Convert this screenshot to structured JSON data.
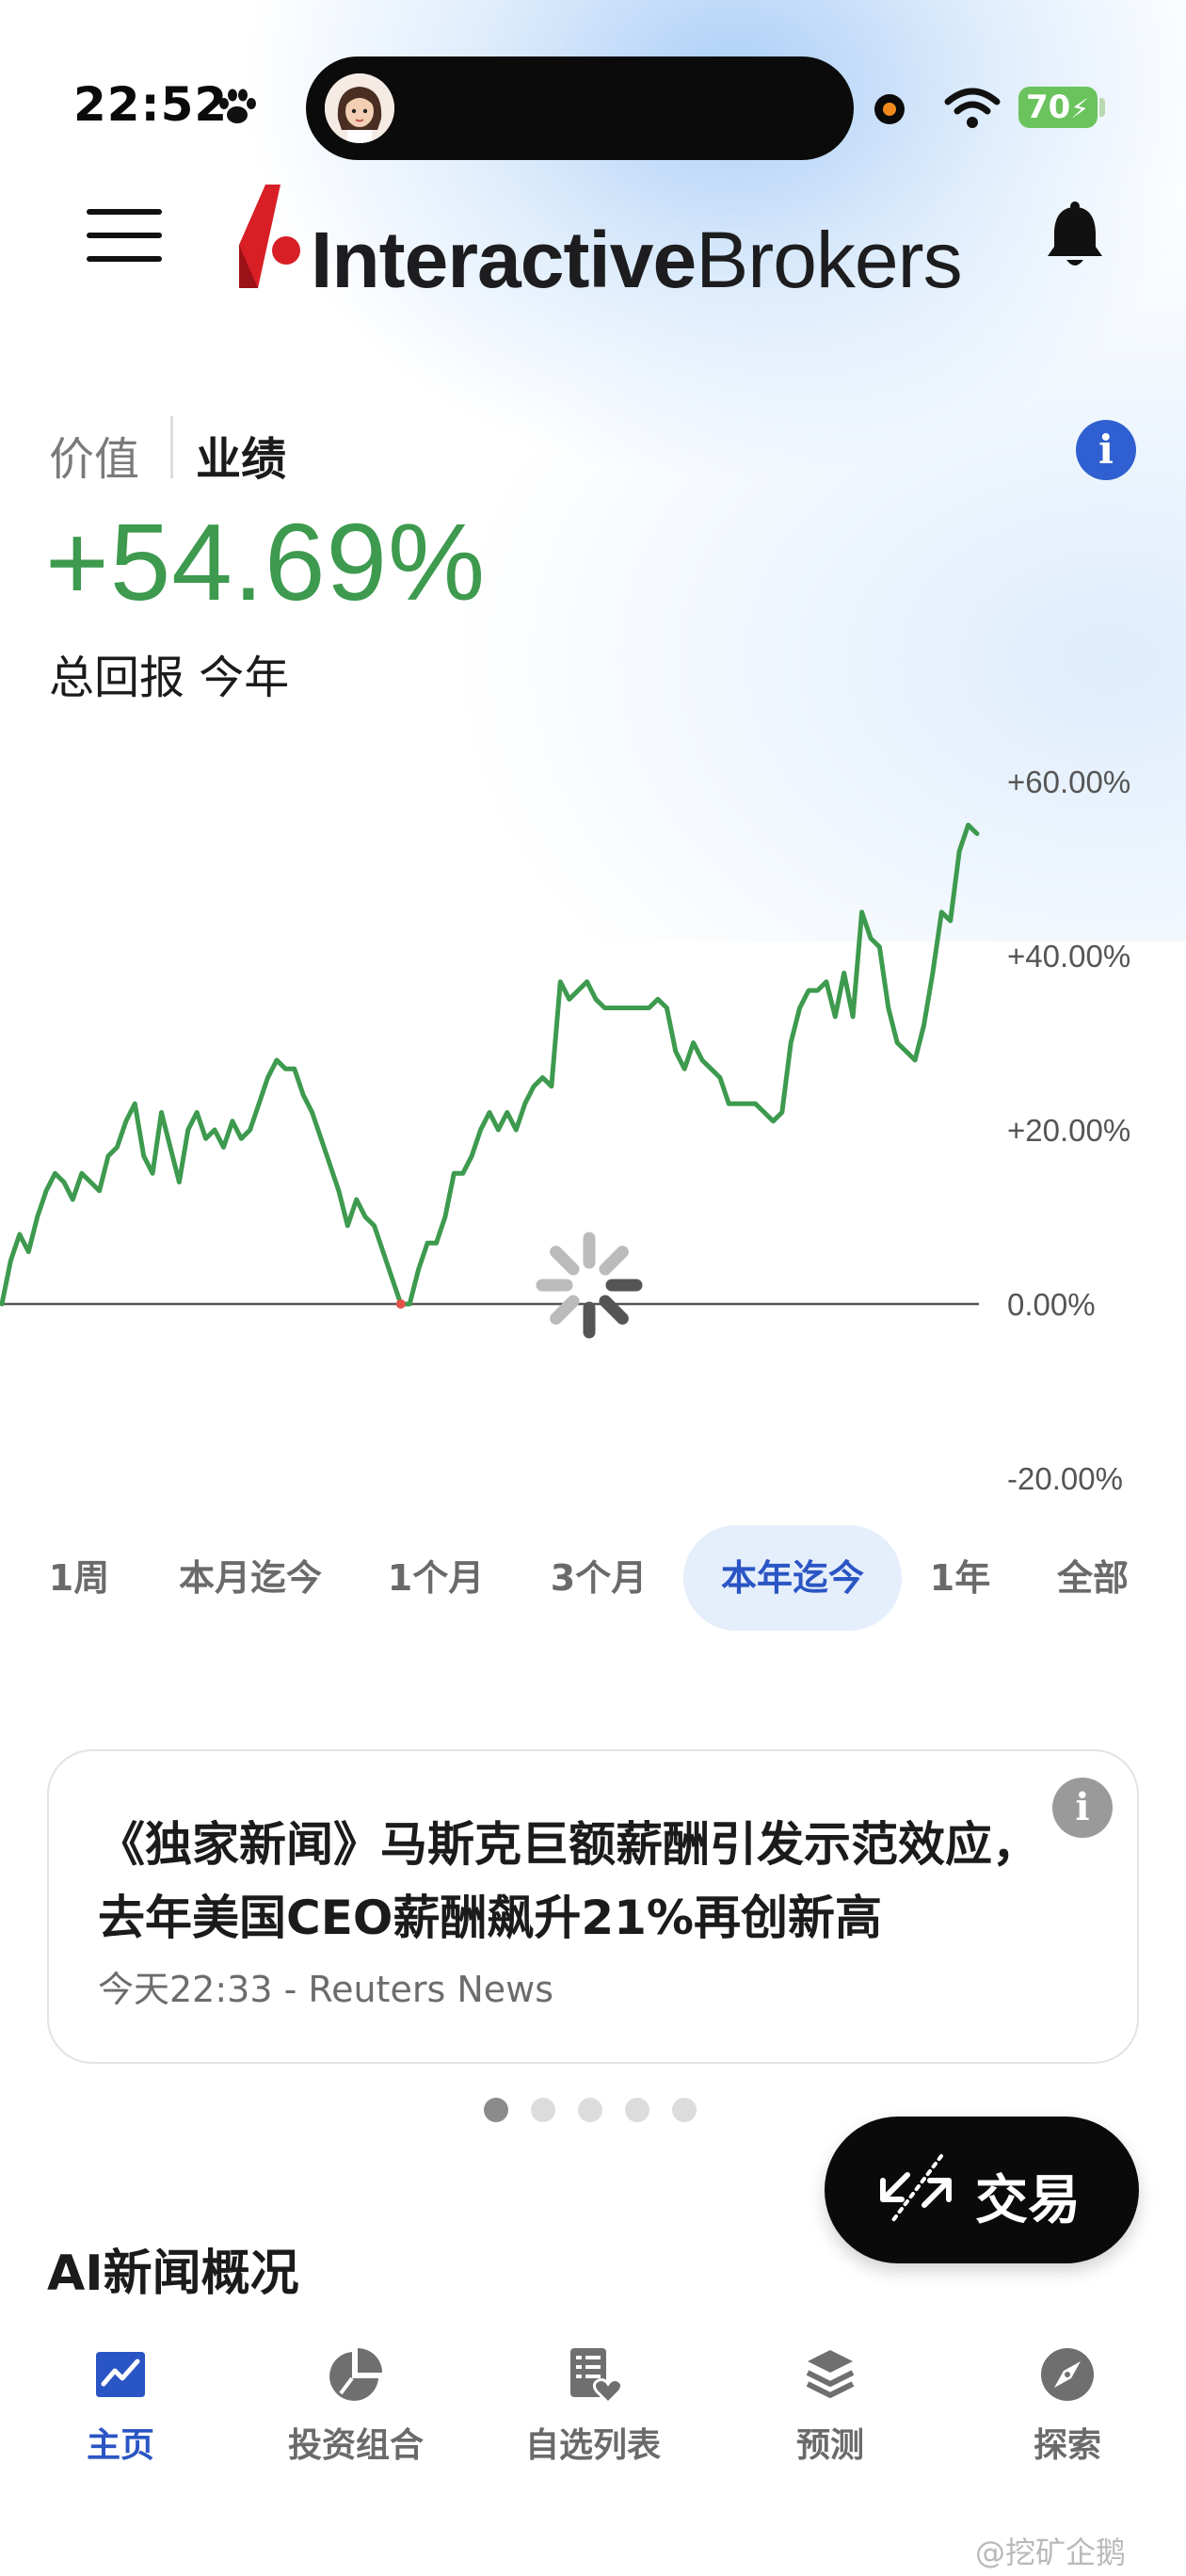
{
  "status_bar": {
    "time": "22:52",
    "battery": "70",
    "icons": [
      "paw-icon",
      "wifi-icon",
      "battery-icon"
    ]
  },
  "header": {
    "brand_bold": "Interactive",
    "brand_regular": "Brokers",
    "icons": [
      "menu-icon",
      "bell-icon"
    ]
  },
  "performance": {
    "tab_value": "价值",
    "tab_performance": "业绩",
    "active_tab": "业绩",
    "total_return": "+54.69%",
    "label": "总回报 今年",
    "accent_color": "#3d9a4e"
  },
  "chart_data": {
    "type": "line",
    "y_tick_labels": [
      "+60.00%",
      "+40.00%",
      "+20.00%",
      "0.00%",
      "-20.00%"
    ],
    "ylim": [
      -20,
      60
    ],
    "grid": false,
    "series": [
      {
        "color": "#3d9a4e",
        "values": [
          0,
          5,
          8,
          6,
          10,
          13,
          15,
          14,
          12,
          15,
          14,
          13,
          17,
          18,
          21,
          23,
          17,
          15,
          22,
          18,
          14,
          20,
          22,
          19,
          20,
          18,
          21,
          19,
          20,
          23,
          26,
          28,
          27,
          27,
          24,
          22,
          19,
          16,
          13,
          9,
          12,
          10,
          9,
          6,
          3,
          0,
          0,
          4,
          7,
          7,
          10,
          15,
          15,
          17,
          20,
          22,
          20,
          22,
          20,
          23,
          25,
          26,
          25,
          37,
          35,
          36,
          37,
          35,
          34,
          34,
          34,
          34,
          34,
          34,
          35,
          34,
          29,
          27,
          30,
          28,
          27,
          26,
          23,
          23,
          23,
          23,
          22,
          21,
          22,
          30,
          34,
          36,
          36,
          37,
          33,
          38,
          33,
          45,
          42,
          41,
          34,
          30,
          29,
          28,
          32,
          38,
          45,
          44,
          52,
          55,
          54
        ]
      }
    ],
    "baseline_value": 0,
    "loading_spinner": true
  },
  "time_range": {
    "options": [
      "1周",
      "本月迄今",
      "1个月",
      "3个月",
      "本年迄今",
      "1年",
      "全部"
    ],
    "active": "本年迄今"
  },
  "news": {
    "title": "《独家新闻》马斯克巨额薪酬引发示范效应，去年美国CEO薪酬飙升21%再创新高",
    "meta": "今天22:33 - Reuters News",
    "page_count": 5,
    "active_page": 1
  },
  "trade_button": {
    "label": "交易"
  },
  "section": {
    "ai_title": "AI新闻概况"
  },
  "bottom_nav": {
    "items": [
      {
        "label": "主页",
        "icon": "chart-line-icon",
        "active": true
      },
      {
        "label": "投资组合",
        "icon": "pie-chart-icon",
        "active": false
      },
      {
        "label": "自选列表",
        "icon": "watchlist-heart-icon",
        "active": false
      },
      {
        "label": "预测",
        "icon": "layers-icon",
        "active": false
      },
      {
        "label": "探索",
        "icon": "compass-icon",
        "active": false
      }
    ],
    "active_color": "#2a55c4"
  },
  "watermark": "@挖矿企鹅"
}
